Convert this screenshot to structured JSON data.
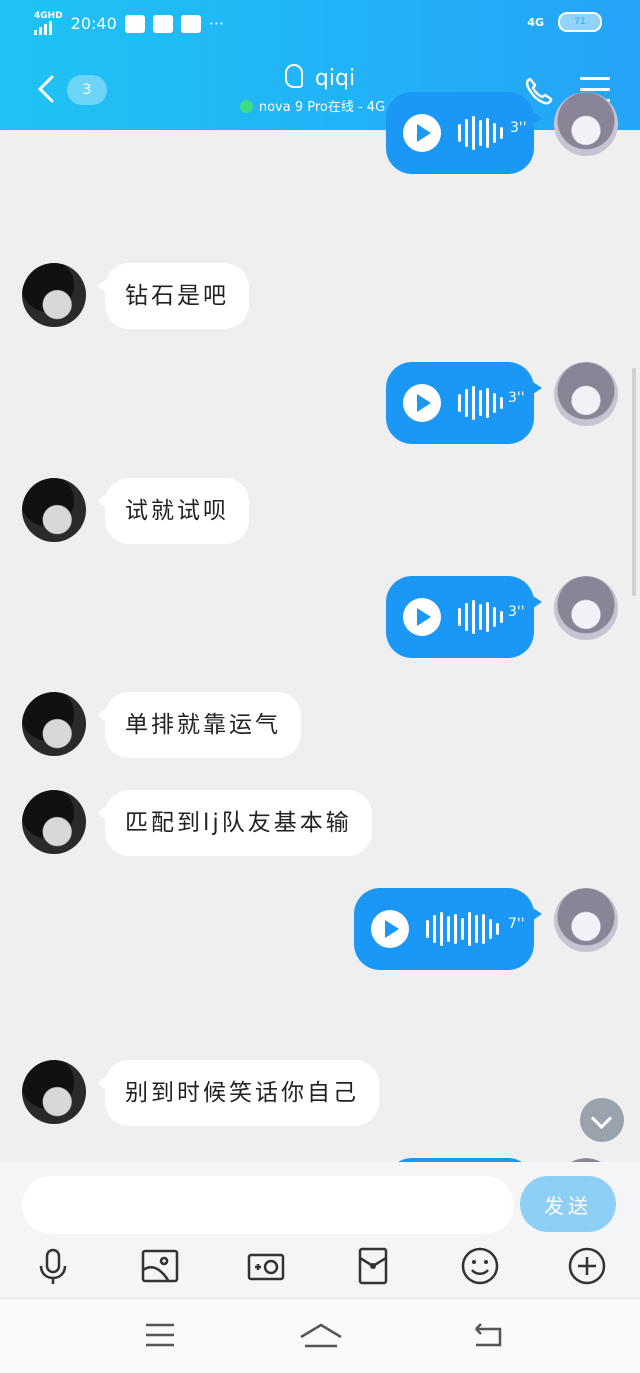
{
  "status_bar": {
    "network": "4GHD",
    "time": "20:40",
    "dots": "···",
    "network_right": "4G",
    "battery": "71"
  },
  "header": {
    "unread_count": "3",
    "title": "qiqi",
    "subtitle": "nova 9 Pro在线 - 4G >"
  },
  "messages": [
    {
      "side": "left",
      "type": "text",
      "text": "钻石是吧"
    },
    {
      "side": "right",
      "type": "voice",
      "duration": "3''"
    },
    {
      "side": "left",
      "type": "text",
      "text": "试就试呗"
    },
    {
      "side": "right",
      "type": "voice",
      "duration": "3''"
    },
    {
      "side": "left",
      "type": "text",
      "text": "单排就靠运气"
    },
    {
      "side": "left",
      "type": "text",
      "text": "匹配到lj队友基本输"
    },
    {
      "side": "right",
      "type": "voice",
      "duration": "7''"
    },
    {
      "side": "left",
      "type": "text",
      "text": "别到时候笑话你自己"
    }
  ],
  "top_partial_voice": {
    "duration": "3''"
  },
  "composer": {
    "placeholder": "",
    "send_label": "发送"
  },
  "toolbar": [
    "mic-icon",
    "image-icon",
    "camera-icon",
    "red-packet-icon",
    "emoji-icon",
    "plus-icon"
  ],
  "system_nav": [
    "menu-icon",
    "home-icon",
    "back-icon"
  ]
}
